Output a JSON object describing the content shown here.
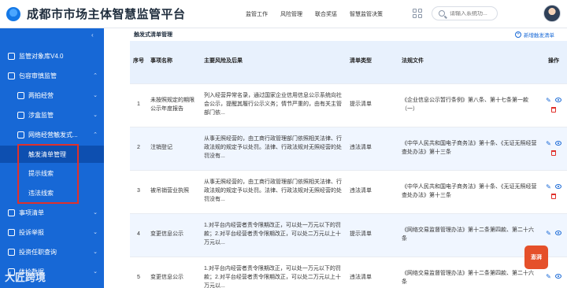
{
  "header": {
    "title": "成都市市场主体智慧监管平台",
    "nav": [
      "监管工作",
      "风险管理",
      "联合奖惩",
      "智慧监管决策"
    ],
    "search_placeholder": "请输入系统功..."
  },
  "sidebar": {
    "items": [
      {
        "label": "监管对象库V4.0",
        "icon": "database-icon",
        "caret": ""
      },
      {
        "label": "包容审慎监管",
        "icon": "folder-icon",
        "caret": "⌃"
      },
      {
        "label": "两拍经营",
        "icon": "doc-icon",
        "caret": "⌄"
      },
      {
        "label": "涉盒监管",
        "icon": "doc-icon",
        "caret": "⌄"
      },
      {
        "label": "网络经营触发式...",
        "icon": "doc-icon",
        "caret": "⌃"
      },
      {
        "label": "触发清单管理",
        "icon": "",
        "caret": ""
      },
      {
        "label": "提示线索",
        "icon": "",
        "caret": ""
      },
      {
        "label": "违法线索",
        "icon": "",
        "caret": ""
      },
      {
        "label": "事项清单",
        "icon": "list-icon",
        "caret": "⌄"
      },
      {
        "label": "投诉举报",
        "icon": "report-icon",
        "caret": "⌄"
      },
      {
        "label": "投资任职查询",
        "icon": "query-icon",
        "caret": "⌄"
      },
      {
        "label": "体检数据",
        "icon": "data-icon",
        "caret": "⌄"
      }
    ]
  },
  "main": {
    "section_title": "触发式清单管理",
    "add_label": "新增触发清单",
    "columns": [
      "序号",
      "事项名称",
      "主要风险及后果",
      "清单类型",
      "法规文件",
      "操作"
    ],
    "rows": [
      {
        "idx": "1",
        "name": "未按照规定的期限公示年度报告",
        "risk": "列入经营异常名录，通过国家企业信用信息公示系统向社会公示，提醒其履行公示义务；情节严重的，由有关主管部门依...",
        "type": "提示清单",
        "law": "《企业信息公示暂行条例》第八条、第十七条第一款（一）",
        "deletable": true
      },
      {
        "idx": "2",
        "name": "注销登记",
        "risk": "从事无照经营的，由工商行政管理部门依照相关法律、行政法规的规定予以处罚。法律、行政法规对无照经营的处罚没有...",
        "type": "违法清单",
        "law": "《中华人民共和国电子商务法》第十条、《无证无照经营查处办法》第十三条",
        "deletable": true
      },
      {
        "idx": "3",
        "name": "被吊销营业执照",
        "risk": "从事无照经营的，由工商行政管理部门依照相关法律、行政法规的规定予以处罚。法律、行政法规对无照经营的处罚没有...",
        "type": "违法清单",
        "law": "《中华人民共和国电子商务法》第十条、《无证无照经营查处办法》第十三条",
        "deletable": true
      },
      {
        "idx": "4",
        "name": "变更信息公示",
        "risk": "1.对平台内经营者责令限期改正，可以处一万元以下的罚款；2.对平台经营者责令限期改正，可以处二万元以上十万元以...",
        "type": "提示清单",
        "law": "《网络交易监督管理办法》第十二条第四款、第二十六条",
        "deletable": false
      },
      {
        "idx": "5",
        "name": "变更信息公示",
        "risk": "1.对平台内经营者责令限期改正，可以处一万元以下的罚款；2.对平台经营者责令限期改正，可以处二万元以上十万元以...",
        "type": "违法清单",
        "law": "《网络交易监督管理办法》第十二条第四款、第二十六条",
        "deletable": false
      }
    ]
  },
  "watermark": "大匠跨境",
  "badge": "澎湃"
}
